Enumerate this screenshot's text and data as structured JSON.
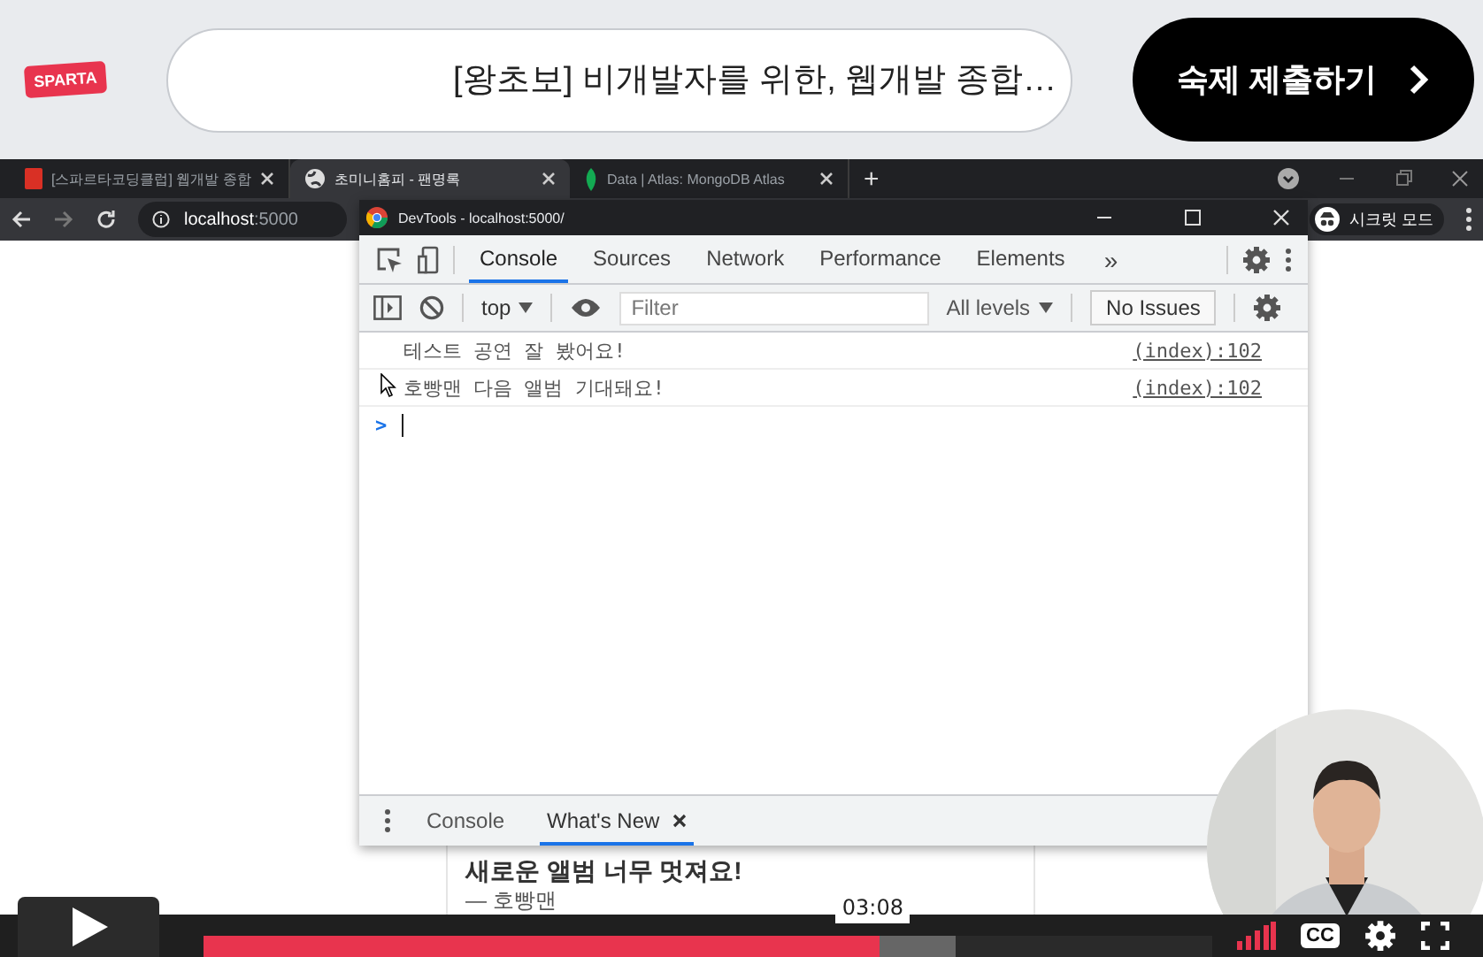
{
  "header": {
    "logo": "SPARTA",
    "course_title": "[왕초보] 비개발자를 위한, 웹개발 종합…",
    "submit_button": "숙제 제출하기"
  },
  "browser": {
    "tabs": [
      {
        "kind": "doc",
        "title": "[스파르타코딩클럽] 웹개발 종합",
        "selected": false
      },
      {
        "kind": "globe",
        "title": "초미니홈피 - 팬명록",
        "selected": true
      },
      {
        "kind": "leaf",
        "title": "Data | Atlas: MongoDB Atlas",
        "selected": false
      }
    ],
    "new_tab": "+",
    "host": "localhost",
    "port": ":5000",
    "incognito": "시크릿 모드"
  },
  "devtools": {
    "title": "DevTools - localhost:5000/",
    "tabs": [
      {
        "label": "Console",
        "selected": true
      },
      {
        "label": "Sources",
        "selected": false
      },
      {
        "label": "Network",
        "selected": false
      },
      {
        "label": "Performance",
        "selected": false
      },
      {
        "label": "Elements",
        "selected": false
      }
    ],
    "more": "»",
    "context": "top",
    "filter_placeholder": "Filter",
    "levels": "All levels",
    "issues": "No Issues",
    "messages": [
      {
        "text": "테스트 공연 잘 봤어요!",
        "source": "(index):102"
      },
      {
        "text": "호빵맨 다음 앨범 기대돼요!",
        "source": "(index):102"
      }
    ],
    "prompt": ">",
    "drawer_tabs": [
      {
        "label": "Console",
        "selected": false,
        "closable": false
      },
      {
        "label": "What's New",
        "selected": true,
        "closable": true
      }
    ]
  },
  "page": {
    "card_title": "새로운 앨범 너무 멋져요!",
    "card_author": "— 호빵맨"
  },
  "player": {
    "level": 0.67,
    "time": "03:08",
    "captions": "CC"
  }
}
